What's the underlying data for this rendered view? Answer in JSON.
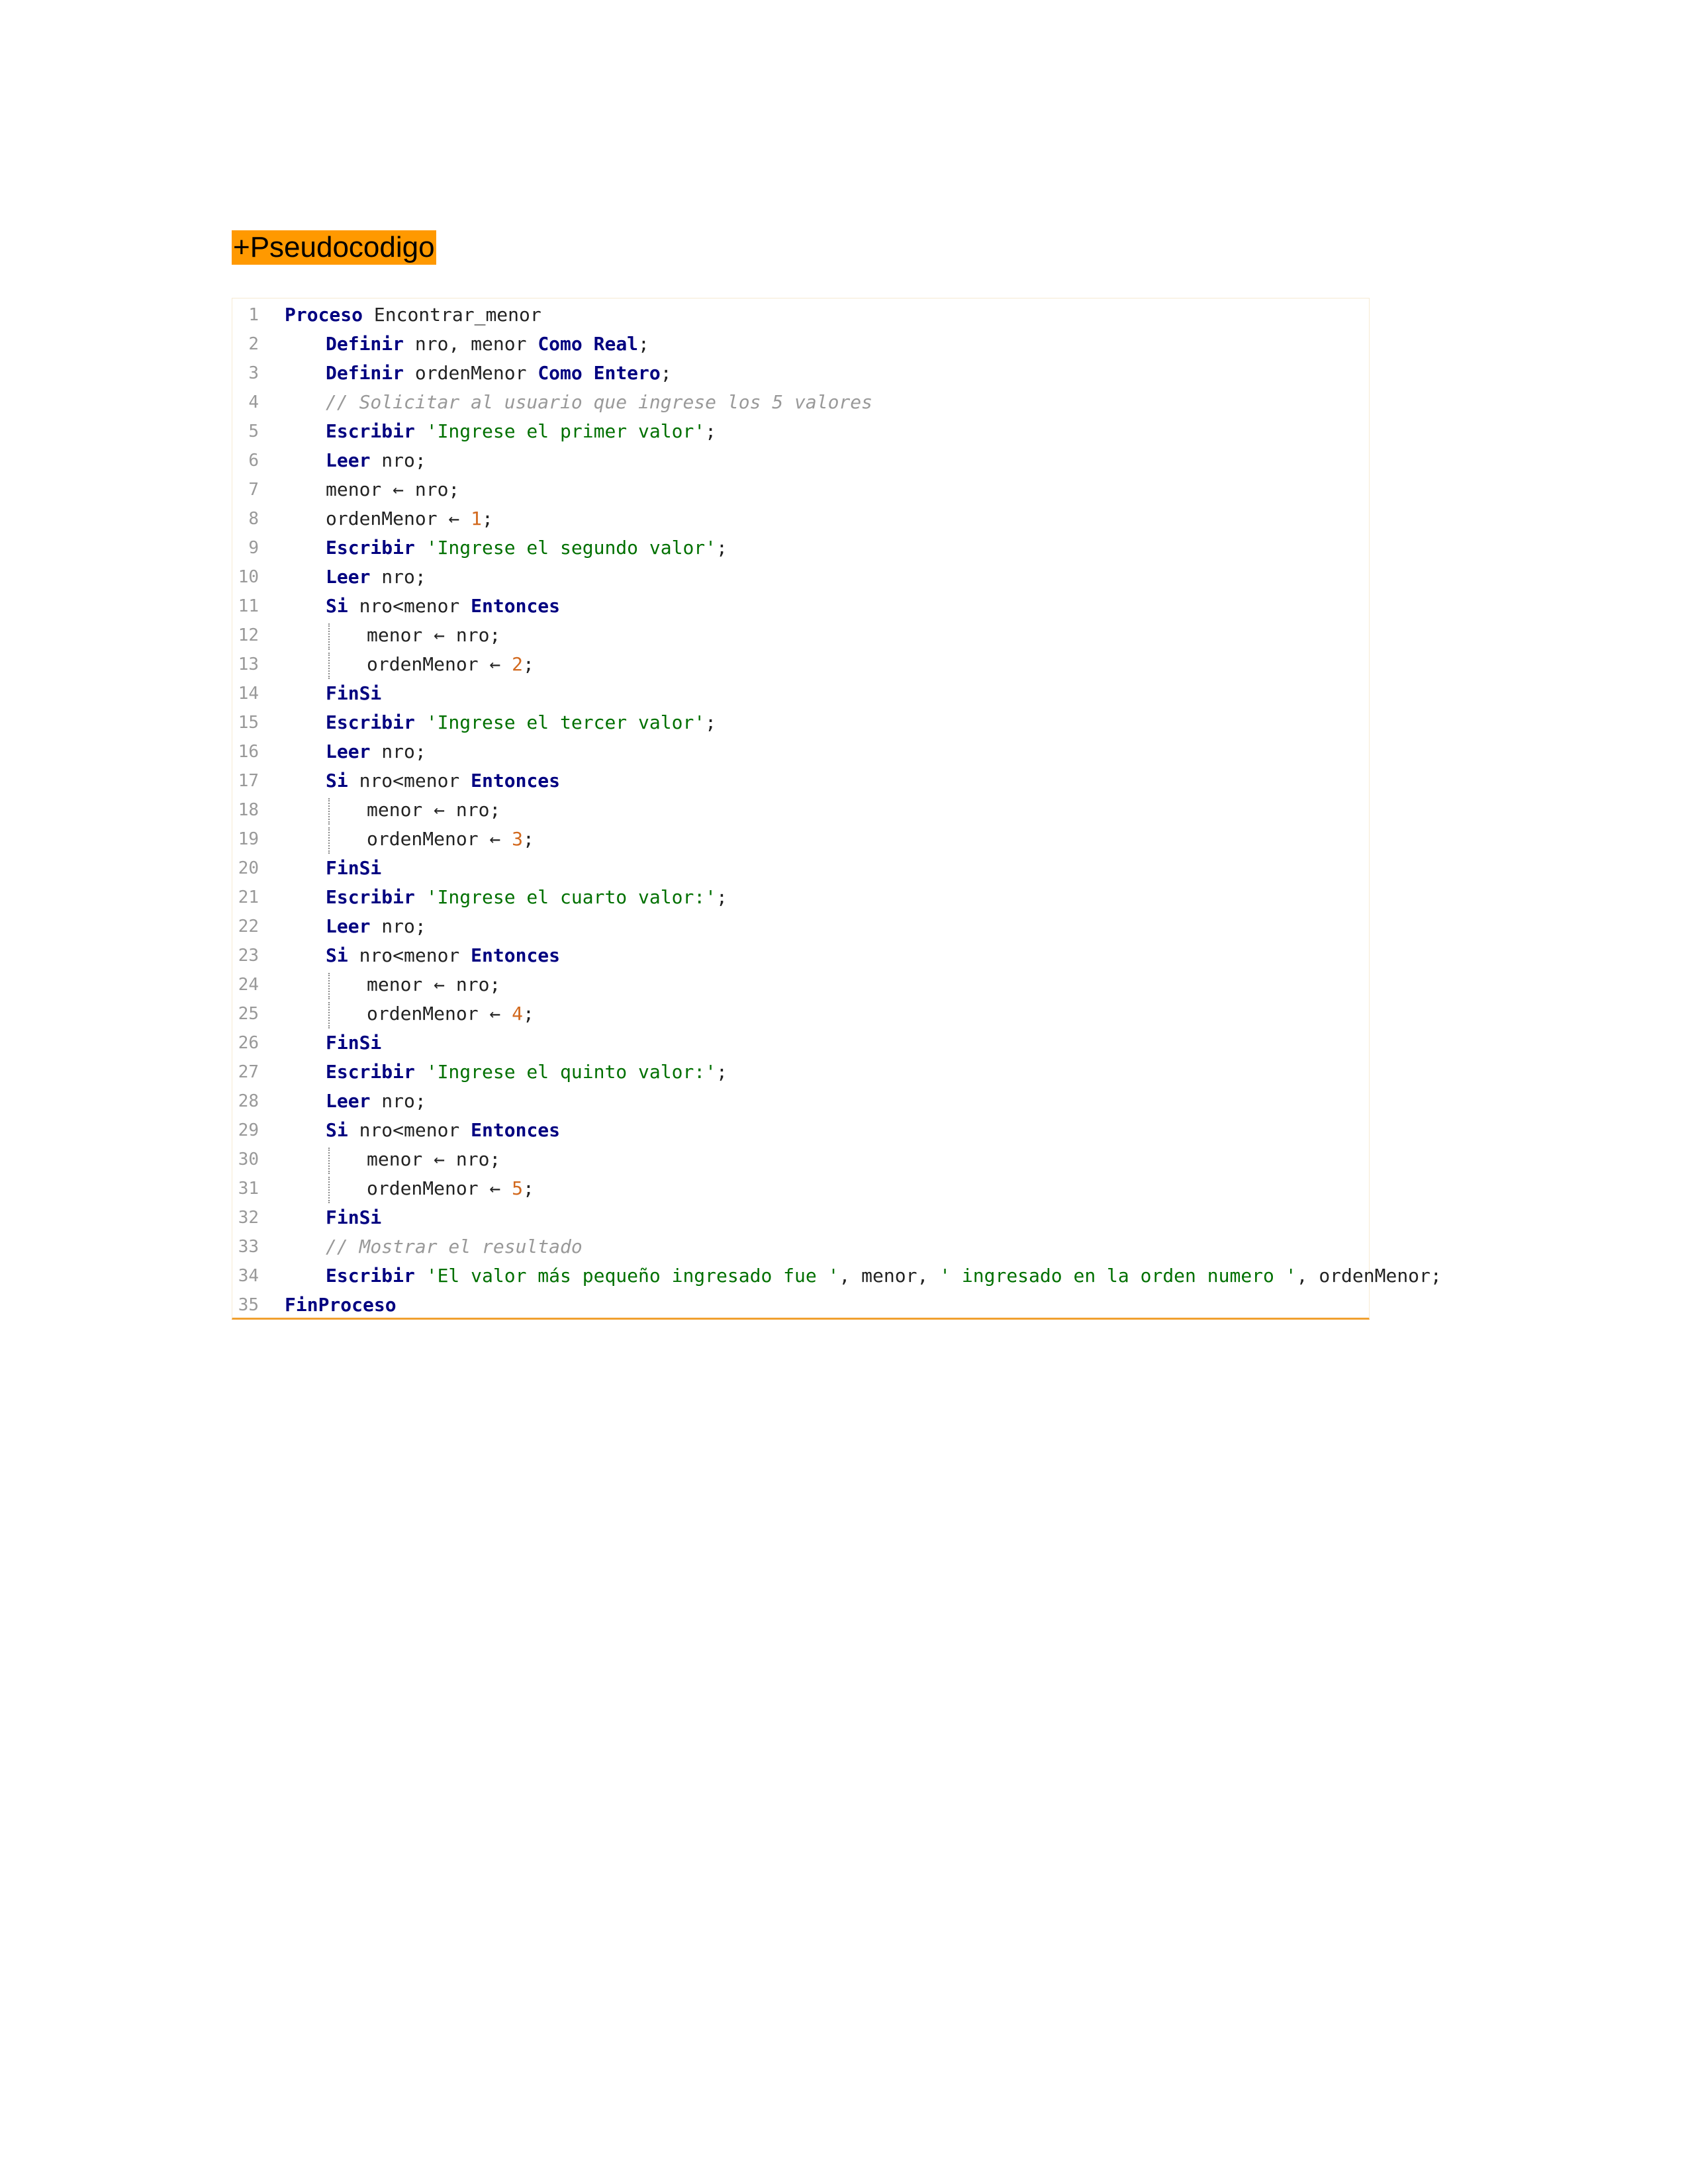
{
  "heading": "+Pseudocodigo",
  "code": {
    "lines": [
      {
        "indent": 0,
        "tokens": [
          [
            "kw",
            "Proceso"
          ],
          [
            "id",
            " Encontrar_menor"
          ]
        ]
      },
      {
        "indent": 1,
        "tokens": [
          [
            "kw",
            "Definir"
          ],
          [
            "id",
            " nro, menor "
          ],
          [
            "kw",
            "Como Real"
          ],
          [
            "id",
            ";"
          ]
        ]
      },
      {
        "indent": 1,
        "tokens": [
          [
            "kw",
            "Definir"
          ],
          [
            "id",
            " ordenMenor "
          ],
          [
            "kw",
            "Como Entero"
          ],
          [
            "id",
            ";"
          ]
        ]
      },
      {
        "indent": 1,
        "tokens": [
          [
            "cm",
            "// Solicitar al usuario que ingrese los 5 valores"
          ]
        ]
      },
      {
        "indent": 1,
        "tokens": [
          [
            "kw",
            "Escribir"
          ],
          [
            "id",
            " "
          ],
          [
            "str",
            "'Ingrese el primer valor'"
          ],
          [
            "id",
            ";"
          ]
        ]
      },
      {
        "indent": 1,
        "tokens": [
          [
            "kw",
            "Leer"
          ],
          [
            "id",
            " nro;"
          ]
        ]
      },
      {
        "indent": 1,
        "tokens": [
          [
            "id",
            "menor ← nro;"
          ]
        ]
      },
      {
        "indent": 1,
        "tokens": [
          [
            "id",
            "ordenMenor ← "
          ],
          [
            "num",
            "1"
          ],
          [
            "id",
            ";"
          ]
        ]
      },
      {
        "indent": 1,
        "tokens": [
          [
            "kw",
            "Escribir"
          ],
          [
            "id",
            " "
          ],
          [
            "str",
            "'Ingrese el segundo valor'"
          ],
          [
            "id",
            ";"
          ]
        ]
      },
      {
        "indent": 1,
        "tokens": [
          [
            "kw",
            "Leer"
          ],
          [
            "id",
            " nro;"
          ]
        ]
      },
      {
        "indent": 1,
        "tokens": [
          [
            "kw",
            "Si"
          ],
          [
            "id",
            " nro<menor "
          ],
          [
            "kw",
            "Entonces"
          ]
        ]
      },
      {
        "indent": 2,
        "tokens": [
          [
            "id",
            "menor ← nro;"
          ]
        ]
      },
      {
        "indent": 2,
        "tokens": [
          [
            "id",
            "ordenMenor ← "
          ],
          [
            "num",
            "2"
          ],
          [
            "id",
            ";"
          ]
        ]
      },
      {
        "indent": 1,
        "tokens": [
          [
            "kw",
            "FinSi"
          ]
        ]
      },
      {
        "indent": 1,
        "tokens": [
          [
            "kw",
            "Escribir"
          ],
          [
            "id",
            " "
          ],
          [
            "str",
            "'Ingrese el tercer valor'"
          ],
          [
            "id",
            ";"
          ]
        ]
      },
      {
        "indent": 1,
        "tokens": [
          [
            "kw",
            "Leer"
          ],
          [
            "id",
            " nro;"
          ]
        ]
      },
      {
        "indent": 1,
        "tokens": [
          [
            "kw",
            "Si"
          ],
          [
            "id",
            " nro<menor "
          ],
          [
            "kw",
            "Entonces"
          ]
        ]
      },
      {
        "indent": 2,
        "tokens": [
          [
            "id",
            "menor ← nro;"
          ]
        ]
      },
      {
        "indent": 2,
        "tokens": [
          [
            "id",
            "ordenMenor ← "
          ],
          [
            "num",
            "3"
          ],
          [
            "id",
            ";"
          ]
        ]
      },
      {
        "indent": 1,
        "tokens": [
          [
            "kw",
            "FinSi"
          ]
        ]
      },
      {
        "indent": 1,
        "tokens": [
          [
            "kw",
            "Escribir"
          ],
          [
            "id",
            " "
          ],
          [
            "str",
            "'Ingrese el cuarto valor:'"
          ],
          [
            "id",
            ";"
          ]
        ]
      },
      {
        "indent": 1,
        "tokens": [
          [
            "kw",
            "Leer"
          ],
          [
            "id",
            " nro;"
          ]
        ]
      },
      {
        "indent": 1,
        "tokens": [
          [
            "kw",
            "Si"
          ],
          [
            "id",
            " nro<menor "
          ],
          [
            "kw",
            "Entonces"
          ]
        ]
      },
      {
        "indent": 2,
        "tokens": [
          [
            "id",
            "menor ← nro;"
          ]
        ]
      },
      {
        "indent": 2,
        "tokens": [
          [
            "id",
            "ordenMenor ← "
          ],
          [
            "num",
            "4"
          ],
          [
            "id",
            ";"
          ]
        ]
      },
      {
        "indent": 1,
        "tokens": [
          [
            "kw",
            "FinSi"
          ]
        ]
      },
      {
        "indent": 1,
        "tokens": [
          [
            "kw",
            "Escribir"
          ],
          [
            "id",
            " "
          ],
          [
            "str",
            "'Ingrese el quinto valor:'"
          ],
          [
            "id",
            ";"
          ]
        ]
      },
      {
        "indent": 1,
        "tokens": [
          [
            "kw",
            "Leer"
          ],
          [
            "id",
            " nro;"
          ]
        ]
      },
      {
        "indent": 1,
        "tokens": [
          [
            "kw",
            "Si"
          ],
          [
            "id",
            " nro<menor "
          ],
          [
            "kw",
            "Entonces"
          ]
        ]
      },
      {
        "indent": 2,
        "tokens": [
          [
            "id",
            "menor ← nro;"
          ]
        ]
      },
      {
        "indent": 2,
        "tokens": [
          [
            "id",
            "ordenMenor ← "
          ],
          [
            "num",
            "5"
          ],
          [
            "id",
            ";"
          ]
        ]
      },
      {
        "indent": 1,
        "tokens": [
          [
            "kw",
            "FinSi"
          ]
        ]
      },
      {
        "indent": 1,
        "tokens": [
          [
            "cm",
            "// Mostrar el resultado"
          ]
        ]
      },
      {
        "indent": 1,
        "tokens": [
          [
            "kw",
            "Escribir"
          ],
          [
            "id",
            " "
          ],
          [
            "str",
            "'El valor más pequeño ingresado fue '"
          ],
          [
            "id",
            ", menor, "
          ],
          [
            "str",
            "' ingresado en la orden numero '"
          ],
          [
            "id",
            ", ordenMenor;"
          ]
        ]
      },
      {
        "indent": 0,
        "tokens": [
          [
            "kw",
            "FinProceso"
          ]
        ]
      }
    ]
  }
}
